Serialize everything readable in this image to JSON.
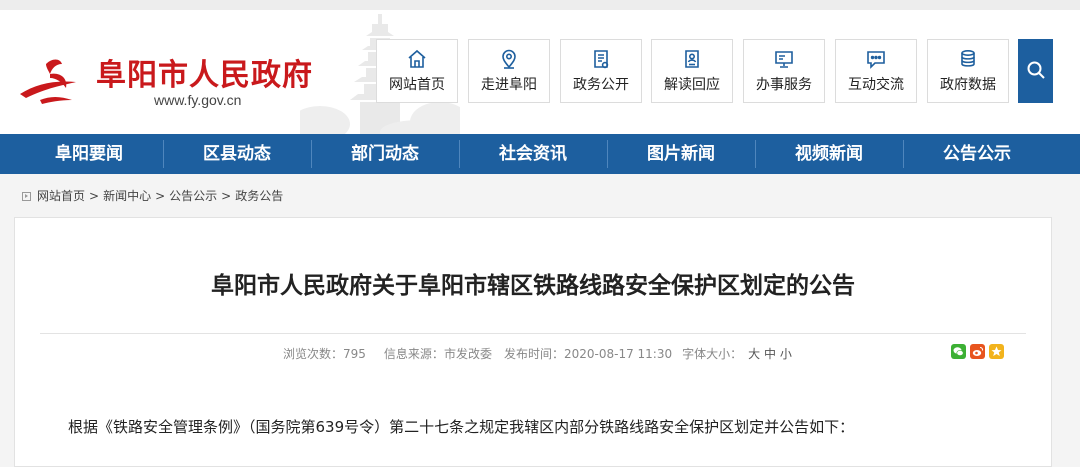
{
  "site": {
    "title": "阜阳市人民政府",
    "url": "www.fy.gov.cn"
  },
  "quick_nav": [
    {
      "label": "网站首页",
      "icon": "home-icon"
    },
    {
      "label": "走进阜阳",
      "icon": "location-pin-icon"
    },
    {
      "label": "政务公开",
      "icon": "document-icon"
    },
    {
      "label": "解读回应",
      "icon": "id-card-icon"
    },
    {
      "label": "办事服务",
      "icon": "monitor-icon"
    },
    {
      "label": "互动交流",
      "icon": "chat-bubble-icon"
    },
    {
      "label": "政府数据",
      "icon": "database-icon"
    }
  ],
  "search": {
    "icon": "search-icon"
  },
  "main_nav": [
    {
      "label": "阜阳要闻"
    },
    {
      "label": "区县动态"
    },
    {
      "label": "部门动态"
    },
    {
      "label": "社会资讯"
    },
    {
      "label": "图片新闻"
    },
    {
      "label": "视频新闻"
    },
    {
      "label": "公告公示"
    }
  ],
  "breadcrumb": {
    "items": [
      "网站首页",
      "新闻中心",
      "公告公示",
      "政务公告"
    ],
    "separator": ">"
  },
  "article": {
    "title": "阜阳市人民政府关于阜阳市辖区铁路线路安全保护区划定的公告",
    "views_label": "浏览次数：",
    "views": "795",
    "source_label": "信息来源：",
    "source": "市发改委",
    "published_label": "发布时间：",
    "published": "2020-08-17 11:30",
    "font_size_label": "字体大小：",
    "font_sizes": [
      "大",
      "中",
      "小"
    ],
    "share_icons": [
      "wechat-icon",
      "weibo-icon",
      "qzone-icon"
    ],
    "body_first_line": "根据《铁路安全管理条例》（国务院第639号令）第二十七条之规定我辖区内部分铁路线路安全保护区划定并公告如下："
  },
  "colors": {
    "brand_red": "#c9191c",
    "nav_blue": "#1d5f9f",
    "wechat_green": "#3cb034",
    "weibo_orange": "#e8541e",
    "qzone_yellow": "#f2b31c"
  }
}
